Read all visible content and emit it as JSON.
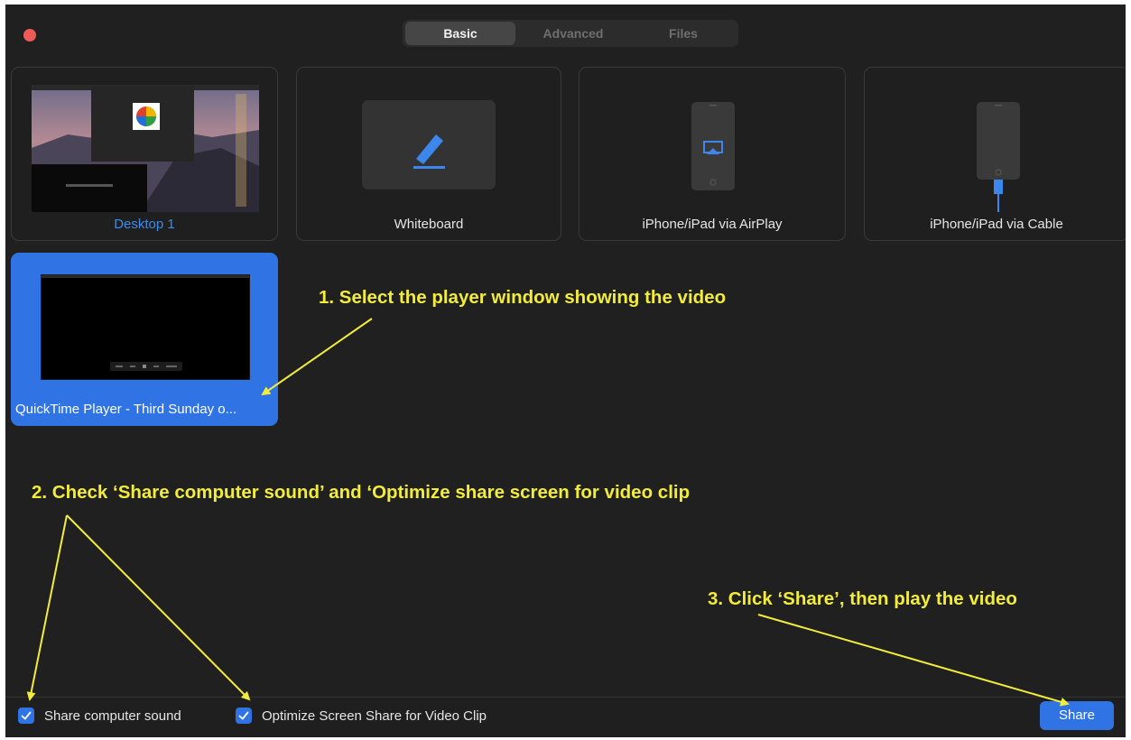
{
  "tabs": [
    {
      "label": "Basic",
      "active": true
    },
    {
      "label": "Advanced",
      "active": false
    },
    {
      "label": "Files",
      "active": false
    }
  ],
  "tiles": {
    "desktop": "Desktop 1",
    "whiteboard": "Whiteboard",
    "airplay": "iPhone/iPad via AirPlay",
    "cable": "iPhone/iPad via Cable",
    "quicktime": "QuickTime Player - Third Sunday o..."
  },
  "annotations": {
    "step1": "1. Select the player window showing the video",
    "step2": "2. Check ‘Share computer sound’ and ‘Optimize share screen for video clip",
    "step3": "3. Click ‘Share’, then play the video"
  },
  "footer": {
    "share_sound": {
      "label": "Share computer sound",
      "checked": true
    },
    "optimize": {
      "label": "Optimize Screen Share for Video Clip",
      "checked": true
    },
    "share_button": "Share"
  },
  "colors": {
    "accent": "#2f73e4",
    "annotation": "#f2ec3c",
    "background": "#202020",
    "close": "#ed5b56"
  }
}
